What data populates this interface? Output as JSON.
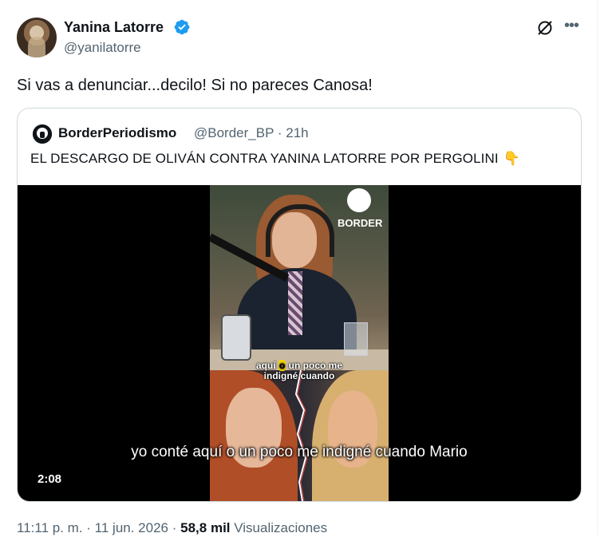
{
  "author": {
    "name": "Yanina Latorre",
    "handle": "@yanilatorre",
    "verified": true
  },
  "tweet": {
    "text": "Si vas a denunciar...decilo! Si no pareces Canosa!"
  },
  "quote": {
    "name": "BorderPeriodismo",
    "handle": "@Border_BP",
    "separator": "·",
    "time": "21h",
    "text": "EL DESCARGO DE OLIVÁN CONTRA YANINA LATORRE POR PERGOLINI",
    "emoji": "👇",
    "video": {
      "logo_text": "BORDER",
      "inner_caption_pre": "aquí",
      "inner_caption_hl": "o",
      "inner_caption_post": "un poco me",
      "inner_caption_line2": "indigné cuando",
      "subtitle": "yo conté aquí o un poco me indigné cuando Mario",
      "duration": "2:08"
    }
  },
  "footer": {
    "time": "11:11 p. m.",
    "dot1": "·",
    "date": "11 jun. 2026",
    "dot2": "·",
    "views_count": "58,8 mil",
    "views_label": "Visualizaciones"
  },
  "colors": {
    "verified": "#1d9bf0",
    "secondary_text": "#536471",
    "border": "#cfd9de"
  },
  "icons": {
    "verified": "verified-badge-icon",
    "grok": "grok-icon",
    "more": "more-options-icon"
  }
}
